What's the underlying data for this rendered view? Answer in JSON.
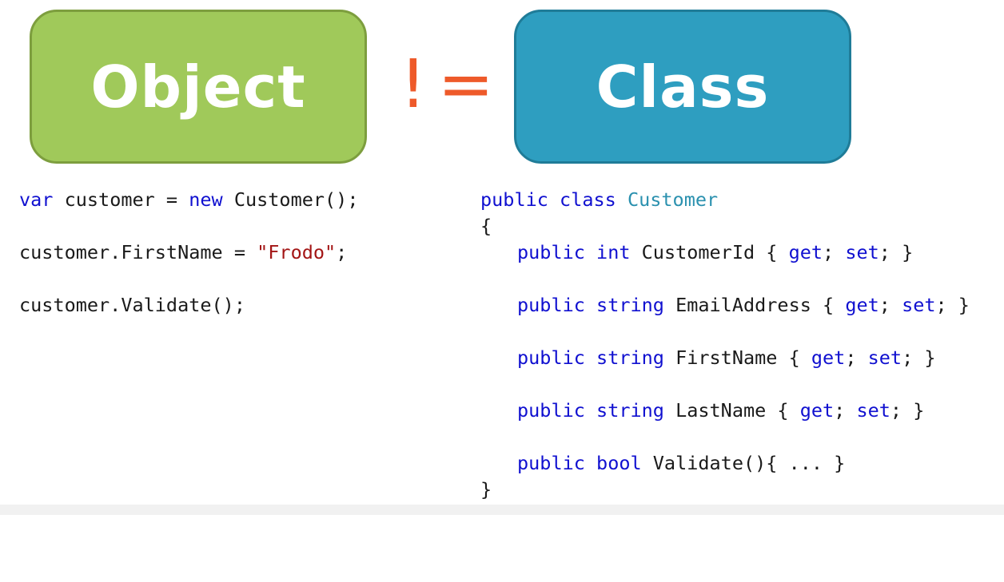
{
  "slide": {
    "object_label": "Object",
    "class_label": "Class",
    "operator": "!=",
    "colors": {
      "object_box": "#a0c95a",
      "class_box": "#2e9ec0",
      "operator": "#ee5a2a",
      "keyword": "#1010d0",
      "string": "#a31515",
      "type": "#2b91af"
    }
  },
  "object_code": {
    "line1": {
      "kw1": "var",
      "t1": " customer = ",
      "kw2": "new",
      "t2": " Customer();"
    },
    "line2": {
      "t1": "customer.FirstName = ",
      "str": "\"Frodo\"",
      "t2": ";"
    },
    "line3": {
      "t1": "customer.Validate();"
    }
  },
  "class_code": {
    "header": {
      "kw1": "public",
      "sp1": " ",
      "kw2": "class",
      "sp2": " ",
      "type": "Customer"
    },
    "open_brace": "{",
    "close_brace": "}",
    "members": [
      {
        "mod": "public",
        "type": "int",
        "name": " CustomerId { ",
        "get": "get",
        "mid": "; ",
        "set": "set",
        "end": "; }"
      },
      {
        "mod": "public",
        "type": "string",
        "name": " EmailAddress { ",
        "get": "get",
        "mid": "; ",
        "set": "set",
        "end": "; }"
      },
      {
        "mod": "public",
        "type": "string",
        "name": " FirstName { ",
        "get": "get",
        "mid": "; ",
        "set": "set",
        "end": "; }"
      },
      {
        "mod": "public",
        "type": "string",
        "name": " LastName { ",
        "get": "get",
        "mid": "; ",
        "set": "set",
        "end": "; }"
      },
      {
        "mod": "public",
        "type": "bool",
        "name": " Validate(){ ... }",
        "get": "",
        "mid": "",
        "set": "",
        "end": ""
      }
    ]
  }
}
